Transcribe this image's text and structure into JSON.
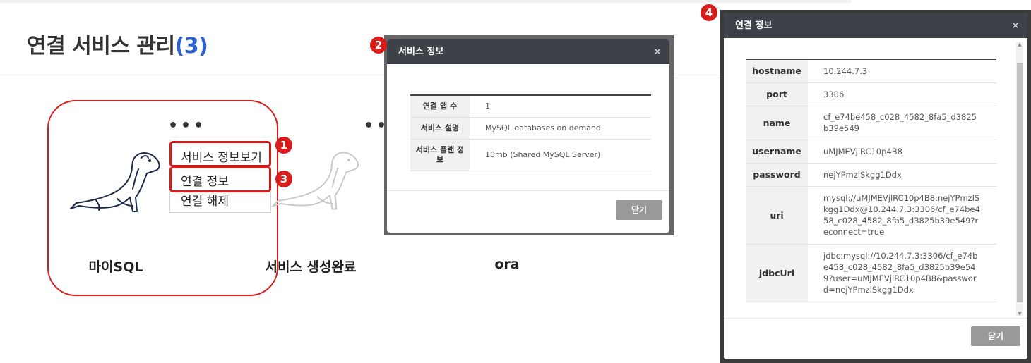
{
  "page": {
    "title": "연결 서비스 관리",
    "count": "(3)"
  },
  "cards": [
    {
      "name": "마이SQL",
      "dots": "•••"
    },
    {
      "name": "서비스 생성완료",
      "dots": "••"
    },
    {
      "name": "ora"
    }
  ],
  "dropdown": {
    "items": [
      "서비스 정보보기",
      "연결 정보",
      "연결 해제"
    ]
  },
  "markers": [
    "1",
    "2",
    "3",
    "4"
  ],
  "service_modal": {
    "title": "서비스 정보",
    "close_icon": "×",
    "rows": [
      {
        "label": "연결 앱 수",
        "value": "1"
      },
      {
        "label": "서비스 설명",
        "value": "MySQL databases on demand"
      },
      {
        "label": "서비스 플랜 정보",
        "value": "10mb (Shared MySQL Server)"
      }
    ],
    "close_label": "닫기"
  },
  "conn_modal": {
    "title": "연결 정보",
    "close_icon": "×",
    "rows": [
      {
        "label": "hostname",
        "value": "10.244.7.3"
      },
      {
        "label": "port",
        "value": "3306"
      },
      {
        "label": "name",
        "value": "cf_e74be458_c028_4582_8fa5_d3825b39e549"
      },
      {
        "label": "username",
        "value": "uMJMEVjlRC10p4B8"
      },
      {
        "label": "password",
        "value": "nejYPmzlSkgg1Ddx"
      },
      {
        "label": "uri",
        "value": "mysql://uMJMEVjlRC10p4B8:nejYPmzlSkgg1Ddx@10.244.7.3:3306/cf_e74be458_c028_4582_8fa5_d3825b39e549?reconnect=true"
      },
      {
        "label": "jdbcUrl",
        "value": "jdbc:mysql://10.244.7.3:3306/cf_e74be458_c028_4582_8fa5_d3825b39e549?user=uMJMEVjlRC10p4B8&password=nejYPmzlSkgg1Ddx"
      }
    ],
    "close_label": "닫기"
  },
  "colors": {
    "accent_red": "#d91c1c",
    "count_blue": "#2c5fd0",
    "modal_header": "#3d4148",
    "seal_dark": "#1b2a4a",
    "seal_light": "#c8c8c8"
  },
  "icons": {
    "seal": "mariadb-seal-icon"
  }
}
